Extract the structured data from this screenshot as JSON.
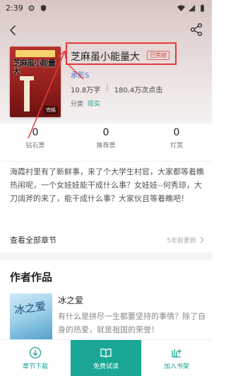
{
  "status_bar": {
    "time": "2:39"
  },
  "book": {
    "title": "芝麻虽小能量大",
    "status_tag": "已完结",
    "author": "承影S",
    "word_count": "10.8万字",
    "clicks": "180.4万次点击",
    "category_label": "分类",
    "category_value": "现实",
    "cover_badge": "完结"
  },
  "counts": [
    {
      "value": "0",
      "label": "钻石票"
    },
    {
      "value": "0",
      "label": "推荐票"
    },
    {
      "value": "0",
      "label": "打赏"
    }
  ],
  "description": "海霞村里有了新鲜事，来了个大学生村官，大家都等着瞧热闹呢，一个女娃娃能干成什么事？女娃娃--何秀琼，大刀阔斧的来了，能干成什么事？大家伙且等着瞧吧！",
  "chapters": {
    "label": "查看全部章节",
    "updated": "5年前更新"
  },
  "author_works": {
    "title": "作者作品",
    "items": [
      {
        "title": "冰之爱",
        "desc": "有什么是拼尽一生都要坚持的事情？除了自身的热爱，就是祖国的荣誉！",
        "cover_text": "冰之爱"
      }
    ]
  },
  "bottom_bar": {
    "download": "章节下载",
    "read_free": "免费试读",
    "add_shelf": "加入书架"
  },
  "colors": {
    "accent": "#1aa795",
    "highlight": "#e53b3b",
    "author_link": "#4a6fd1"
  }
}
